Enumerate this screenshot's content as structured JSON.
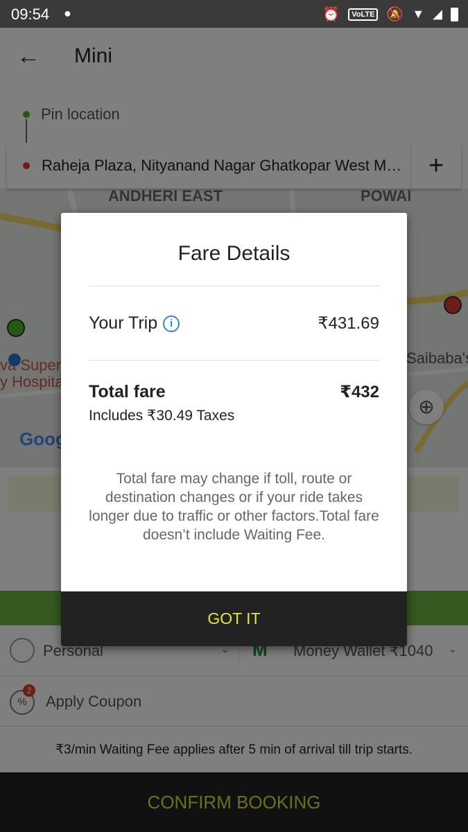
{
  "status": {
    "time": "09:54",
    "volte": "VoLTE"
  },
  "appbar": {
    "title": "Mini"
  },
  "pickup": {
    "label": "Pin location"
  },
  "drop": {
    "address": "Raheja Plaza, Nityanand Nagar Ghatkopar West M…",
    "add": "+"
  },
  "map": {
    "labels": [
      "ANDHERI EAST",
      "POWAI",
      "Saibaba's",
      "va Super",
      "y Hospital",
      "Goog"
    ]
  },
  "booking": {
    "profile": "Personal",
    "wallet": "Money Wallet ₹1040",
    "coupon_label": "Apply Coupon",
    "coupon_badge": "2",
    "waiting_note": "₹3/min Waiting Fee applies after 5 min of arrival till trip starts.",
    "confirm": "CONFIRM BOOKING"
  },
  "modal": {
    "title": "Fare Details",
    "trip_label": "Your Trip",
    "trip_value": "₹431.69",
    "total_label": "Total fare",
    "total_value": "₹432",
    "taxes": "Includes ₹30.49 Taxes",
    "note": "Total fare may change if toll, route or destination changes or if your ride takes longer due to traffic or other factors.Total fare doesn’t include Waiting Fee.",
    "button": "GOT IT"
  }
}
